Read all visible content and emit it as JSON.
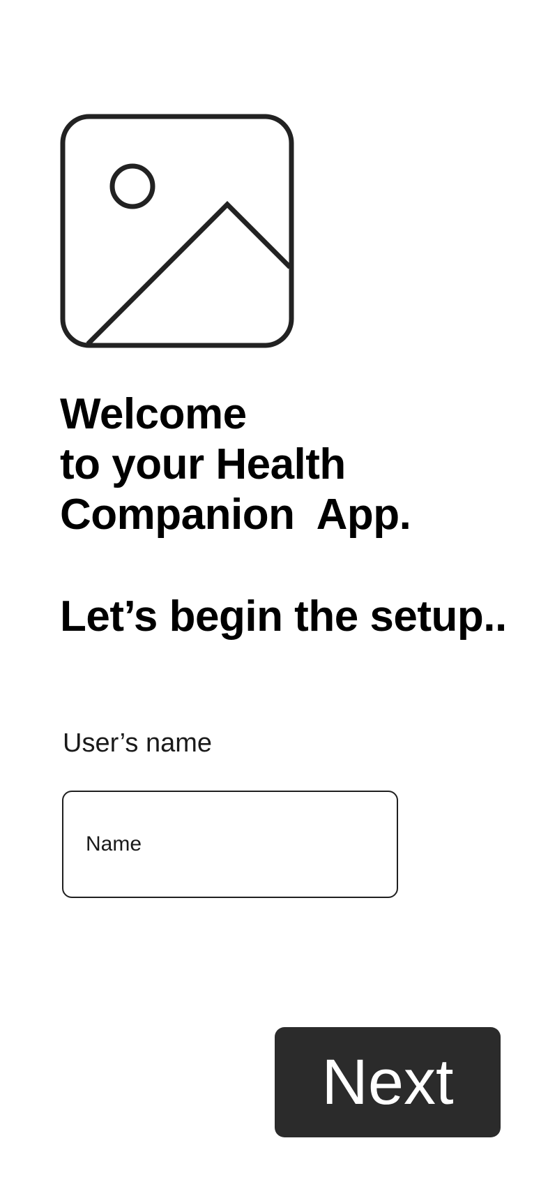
{
  "hero": {
    "icon": "image-placeholder-icon"
  },
  "welcome": {
    "line1": "Welcome",
    "line2": "to your Health",
    "line3": "Companion  App."
  },
  "setup": {
    "subtitle": "Let’s begin the setup.."
  },
  "form": {
    "name_label": "User’s name",
    "name_value": "",
    "name_placeholder": "Name"
  },
  "actions": {
    "next_label": "Next"
  },
  "colors": {
    "button_background": "#2b2b2b",
    "button_text": "#ffffff",
    "text": "#000000",
    "background": "#ffffff"
  }
}
